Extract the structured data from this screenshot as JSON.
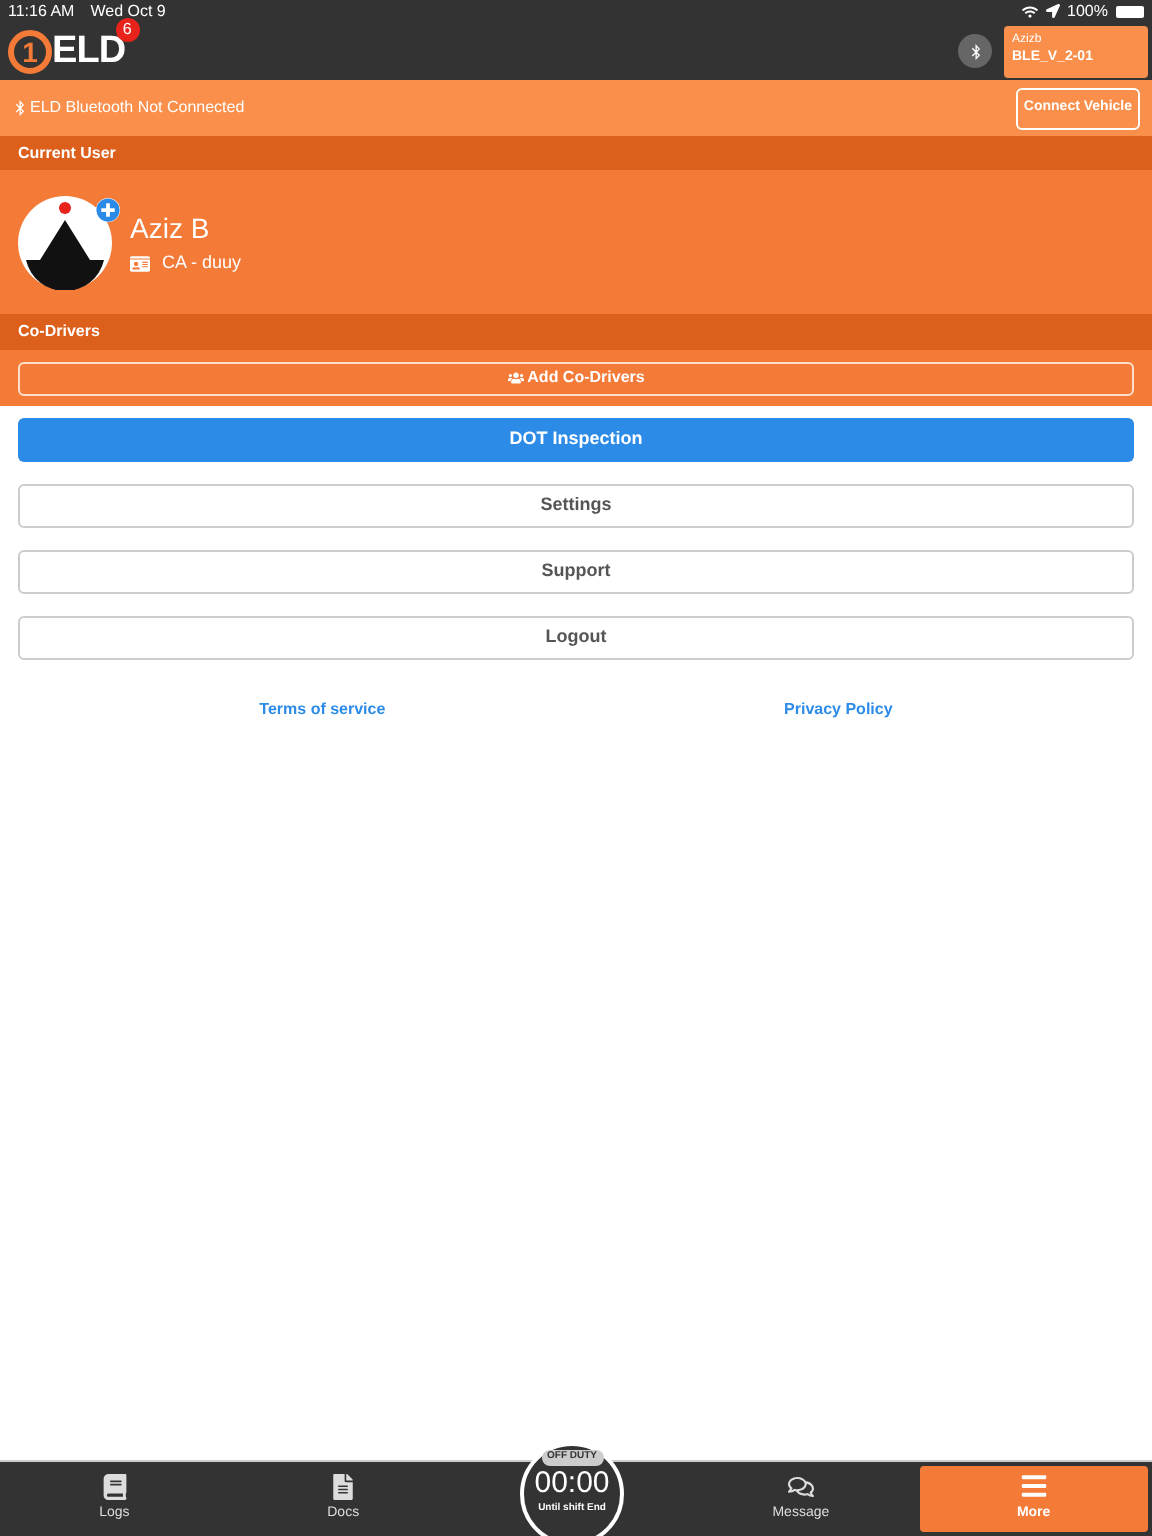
{
  "status_bar": {
    "time": "11:16 AM",
    "date": "Wed Oct 9",
    "battery": "100%"
  },
  "header": {
    "logo_mark": "1",
    "logo_text": "ELD",
    "badge": "6",
    "vehicle_user": "Azizb",
    "vehicle_name": "BLE_V_2-01"
  },
  "banner": {
    "message": "ELD Bluetooth Not Connected",
    "button": "Connect Vehicle"
  },
  "current_user": {
    "heading": "Current User",
    "name": "Aziz B",
    "license": "CA - duuy"
  },
  "co_drivers": {
    "heading": "Co-Drivers",
    "button": "Add Co-Drivers"
  },
  "actions": [
    {
      "label": "DOT Inspection",
      "kind": "primary"
    },
    {
      "label": "Settings",
      "kind": "plain"
    },
    {
      "label": "Support",
      "kind": "plain"
    },
    {
      "label": "Logout",
      "kind": "plain"
    }
  ],
  "links": [
    "Terms of service",
    "Privacy Policy"
  ],
  "tabs": [
    {
      "label": "Logs",
      "kind": "logs",
      "selected": false
    },
    {
      "label": "Docs",
      "kind": "docs",
      "selected": false
    },
    {
      "kind": "timer",
      "status": "OFF DUTY",
      "time": "00:00",
      "caption": "Until shift End"
    },
    {
      "label": "Message",
      "kind": "message",
      "selected": false
    },
    {
      "label": "More",
      "kind": "more",
      "selected": true
    }
  ]
}
